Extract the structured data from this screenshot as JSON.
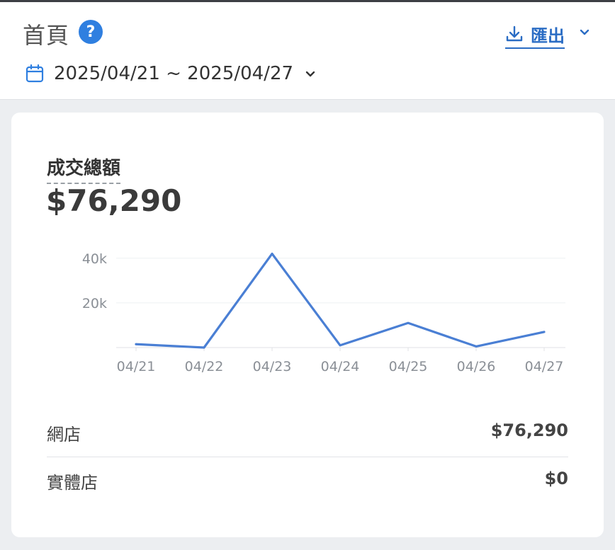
{
  "header": {
    "title": "首頁",
    "help_icon": "question-circle-icon",
    "export_label": "匯出",
    "export_icon": "download-icon",
    "date_range": "2025/04/21 ~ 2025/04/27",
    "date_icon": "calendar-icon"
  },
  "metric": {
    "title": "成交總額",
    "value": "$76,290"
  },
  "chart_data": {
    "type": "line",
    "categories": [
      "04/21",
      "04/22",
      "04/23",
      "04/24",
      "04/25",
      "04/26",
      "04/27"
    ],
    "series": [
      {
        "values": [
          1500,
          0,
          42000,
          1000,
          11000,
          500,
          7000
        ]
      }
    ],
    "y_ticks": [
      "20k",
      "40k"
    ],
    "ylim": [
      0,
      45000
    ],
    "grid": true,
    "color": "#4a7fd4"
  },
  "breakdown": [
    {
      "label": "網店",
      "value": "$76,290"
    },
    {
      "label": "實體店",
      "value": "$0"
    }
  ],
  "colors": {
    "accent": "#2a6cc4",
    "line": "#4a7fd4"
  }
}
